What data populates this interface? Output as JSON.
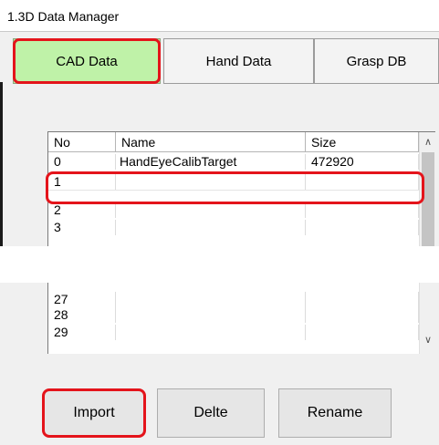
{
  "window": {
    "title": "1.3D Data Manager"
  },
  "tabs": [
    {
      "label": "CAD Data",
      "selected": true
    },
    {
      "label": "Hand Data",
      "selected": false
    },
    {
      "label": "Grasp DB",
      "selected": false
    }
  ],
  "table": {
    "columns": [
      "No",
      "Name",
      "Size"
    ],
    "rows_top": [
      {
        "no": "0",
        "name": "HandEyeCalibTarget",
        "size": "472920"
      },
      {
        "no": "1",
        "name": "",
        "size": ""
      },
      {
        "no": "2",
        "name": "",
        "size": ""
      },
      {
        "no": "3",
        "name": "",
        "size": ""
      }
    ],
    "rows_bottom": [
      {
        "no": "27",
        "name": "",
        "size": ""
      },
      {
        "no": "28",
        "name": "",
        "size": ""
      },
      {
        "no": "29",
        "name": "",
        "size": ""
      }
    ],
    "scroll_up_icon": "chevron-up-icon",
    "scroll_down_icon": "chevron-down-icon"
  },
  "buttons": {
    "import": "Import",
    "delete": "Delte",
    "rename": "Rename"
  },
  "highlight_color": "#e4141b",
  "selected_tab_color": "#bff2a8"
}
